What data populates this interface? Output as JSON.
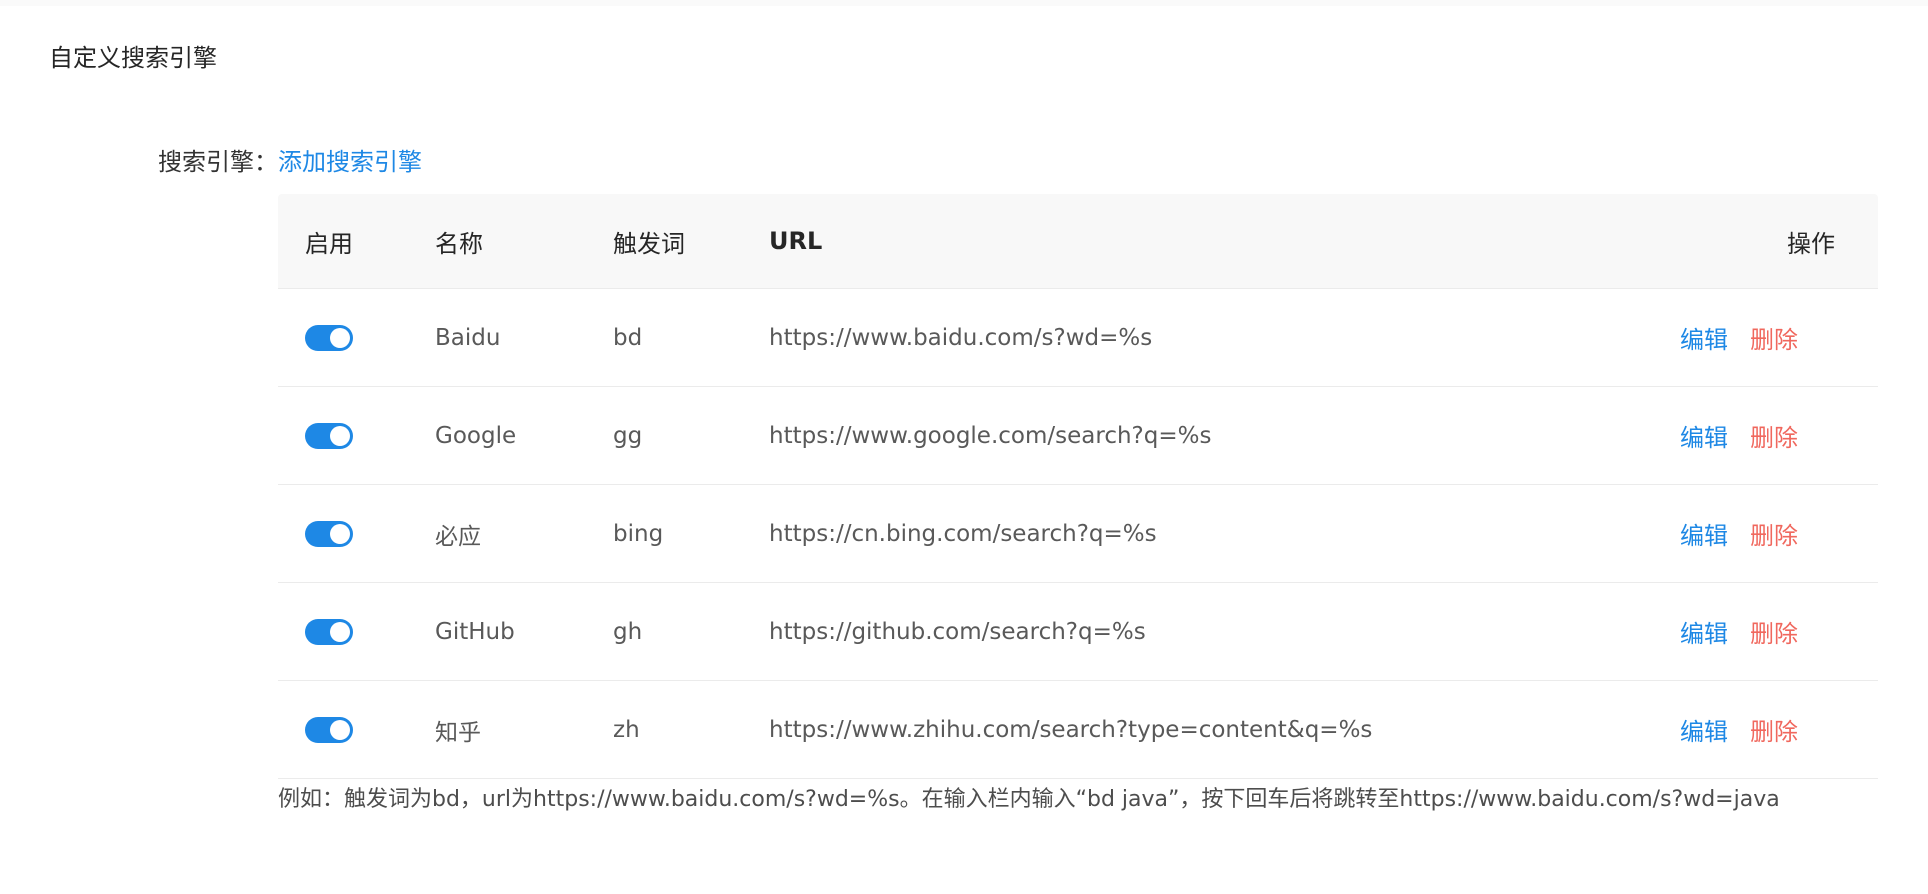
{
  "section": {
    "title": "自定义搜索引擎"
  },
  "field": {
    "label": "搜索引擎：",
    "add_link": "添加搜索引擎"
  },
  "table": {
    "headers": {
      "enable": "启用",
      "name": "名称",
      "trigger": "触发词",
      "url": "URL",
      "ops": "操作"
    },
    "rows": [
      {
        "enabled": true,
        "name": "Baidu",
        "trigger": "bd",
        "url": "https://www.baidu.com/s?wd=%s",
        "edit": "编辑",
        "delete": "删除"
      },
      {
        "enabled": true,
        "name": "Google",
        "trigger": "gg",
        "url": "https://www.google.com/search?q=%s",
        "edit": "编辑",
        "delete": "删除"
      },
      {
        "enabled": true,
        "name": "必应",
        "trigger": "bing",
        "url": "https://cn.bing.com/search?q=%s",
        "edit": "编辑",
        "delete": "删除"
      },
      {
        "enabled": true,
        "name": "GitHub",
        "trigger": "gh",
        "url": "https://github.com/search?q=%s",
        "edit": "编辑",
        "delete": "删除"
      },
      {
        "enabled": true,
        "name": "知乎",
        "trigger": "zh",
        "url": "https://www.zhihu.com/search?type=content&q=%s",
        "edit": "编辑",
        "delete": "删除"
      }
    ]
  },
  "example": "例如：触发词为bd，url为https://www.baidu.com/s?wd=%s。在输入栏内输入“bd java”，按下回车后将跳转至https://www.baidu.com/s?wd=java",
  "colors": {
    "accent": "#1e88e5",
    "danger": "#f0685e",
    "header_bg": "#f8f8f8",
    "divider": "#ebebeb"
  }
}
